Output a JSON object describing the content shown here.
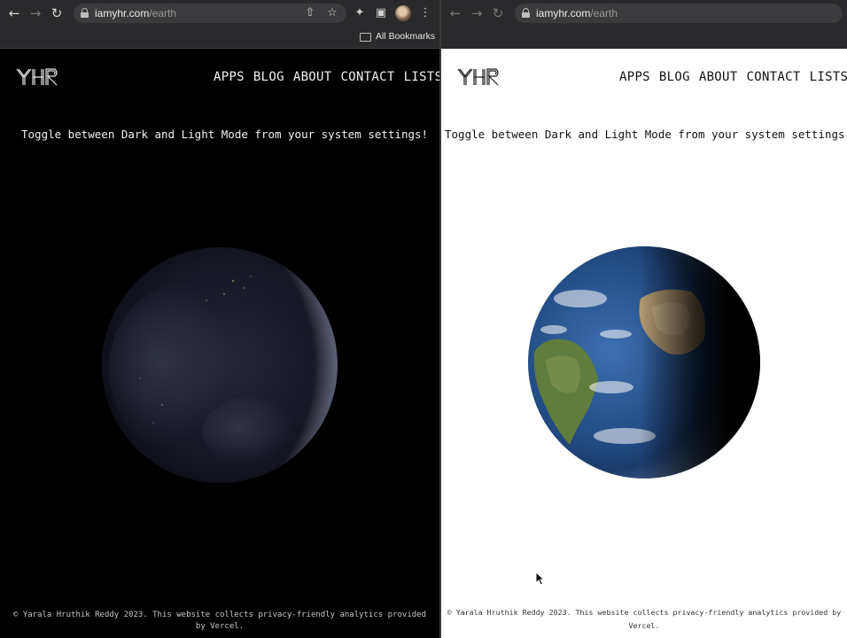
{
  "left_window": {
    "url_host": "iamyhr.com",
    "url_path": "/earth",
    "bookmarks_label": "All Bookmarks",
    "nav": [
      "APPS",
      "BLOG",
      "ABOUT",
      "CONTACT",
      "LISTS"
    ],
    "tagline": "Toggle between Dark and Light Mode from your system settings!",
    "footer_line1": "© Yarala Hruthik Reddy 2023. This website collects privacy-friendly analytics provided",
    "footer_line2": "by Vercel.",
    "theme": "dark"
  },
  "right_window": {
    "url_host": "iamyhr.com",
    "url_path": "/earth",
    "nav": [
      "APPS",
      "BLOG",
      "ABOUT",
      "CONTACT",
      "LISTS"
    ],
    "tagline": "Toggle between Dark and Light Mode from your system settings!",
    "footer_line1": "© Yarala Hruthik Reddy 2023. This website collects privacy-friendly analytics provided by",
    "footer_line2": "Vercel.",
    "theme": "light"
  },
  "icons": {
    "back": "arrow-left-icon",
    "forward": "arrow-right-icon",
    "reload": "reload-icon",
    "share": "share-icon",
    "bookmark": "star-icon",
    "extensions": "puzzle-icon",
    "side_panel": "side-panel-icon",
    "menu": "kebab-menu-icon",
    "folder": "folder-icon"
  },
  "colors": {
    "dark_bg": "#000000",
    "light_bg": "#ffffff",
    "toolbar": "#2a2a2c"
  }
}
